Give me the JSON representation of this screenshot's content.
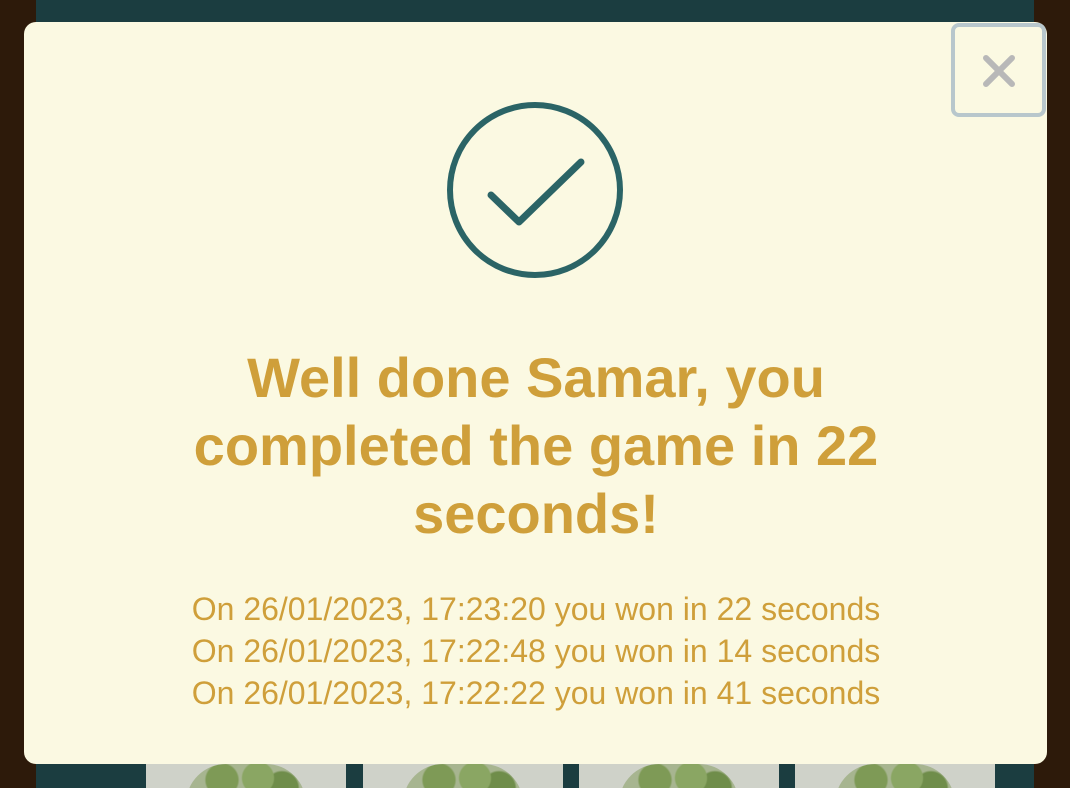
{
  "modal": {
    "close_label": "×",
    "title": "Well done Samar, you completed the game in 22 seconds!",
    "history": [
      "On 26/01/2023, 17:23:20 you won in 22 seconds",
      "On 26/01/2023, 17:22:48 you won in 14 seconds",
      "On 26/01/2023, 17:22:22 you won in 41 seconds"
    ],
    "icon": "checkmark-circle-icon"
  },
  "colors": {
    "modal_background": "#fbf9e2",
    "accent_text": "#cf9f3a",
    "check_icon": "#2b6466",
    "board_background": "#1b3d40",
    "page_background": "#2d1a0a",
    "close_border": "#b8c7cc"
  }
}
